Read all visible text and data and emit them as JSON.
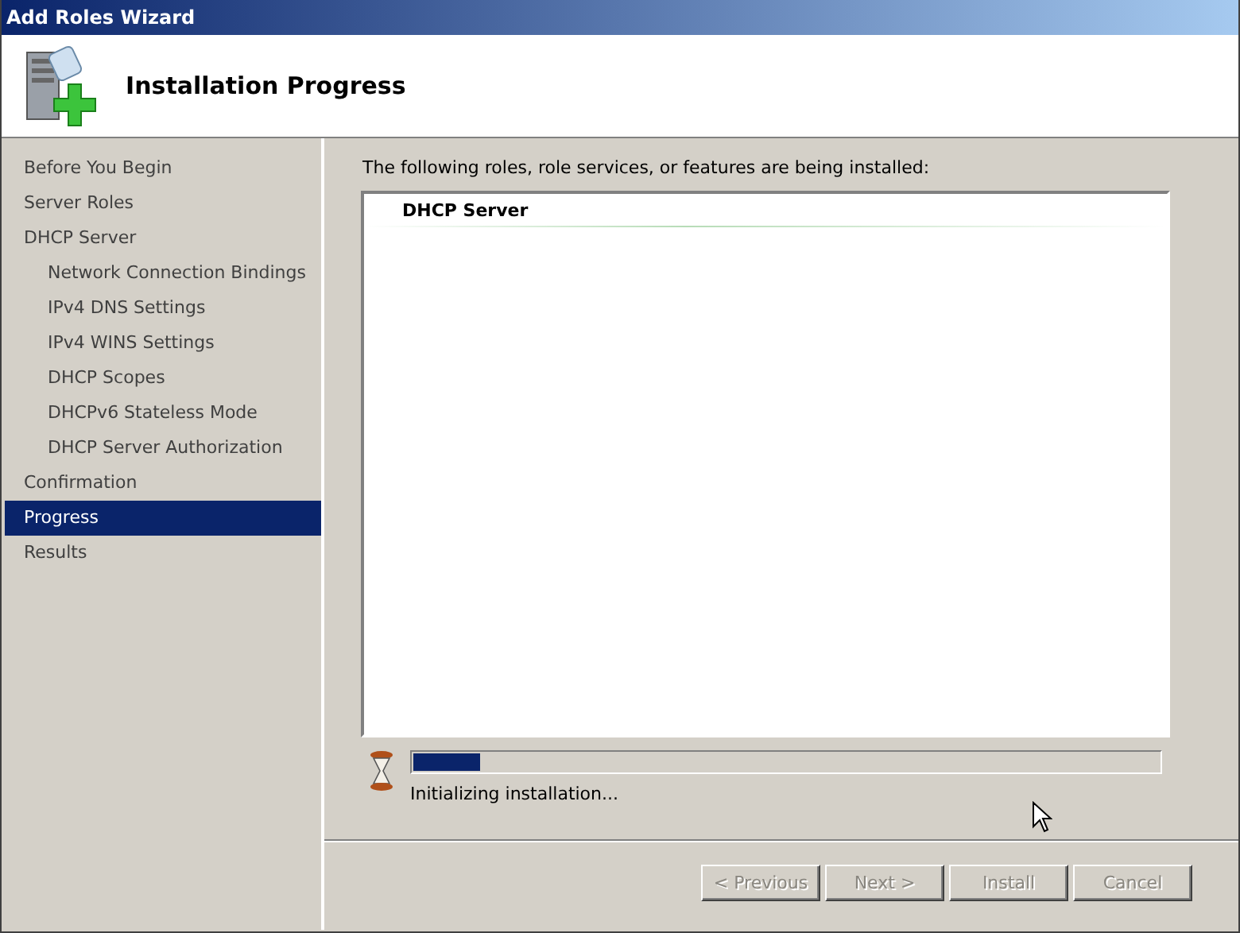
{
  "window": {
    "title": "Add Roles Wizard"
  },
  "header": {
    "title": "Installation Progress"
  },
  "steps": [
    {
      "label": "Before You Begin",
      "selected": false
    },
    {
      "label": "Server Roles",
      "selected": false
    },
    {
      "label": "DHCP Server",
      "selected": false,
      "children": [
        {
          "label": "Network Connection Bindings",
          "selected": false
        },
        {
          "label": "IPv4 DNS Settings",
          "selected": false
        },
        {
          "label": "IPv4 WINS Settings",
          "selected": false
        },
        {
          "label": "DHCP Scopes",
          "selected": false
        },
        {
          "label": "DHCPv6 Stateless Mode",
          "selected": false
        },
        {
          "label": "DHCP Server Authorization",
          "selected": false
        }
      ]
    },
    {
      "label": "Confirmation",
      "selected": false
    },
    {
      "label": "Progress",
      "selected": true
    },
    {
      "label": "Results",
      "selected": false
    }
  ],
  "content": {
    "intro": "The following roles, role services, or features are being installed:",
    "items": [
      "DHCP Server"
    ],
    "progress": {
      "level": 0.09,
      "status": "Initializing installation..."
    }
  },
  "buttons": [
    {
      "label": "< Previous",
      "disabled": true
    },
    {
      "label": "Next >",
      "disabled": true
    },
    {
      "label": "Install",
      "disabled": true
    },
    {
      "label": "Cancel",
      "disabled": true
    }
  ]
}
